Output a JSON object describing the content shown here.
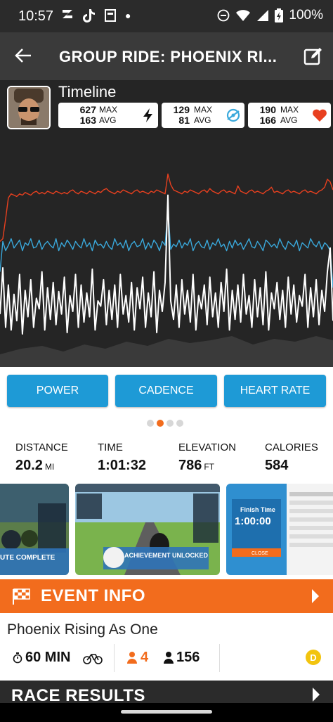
{
  "status_bar": {
    "time": "10:57",
    "battery": "100%",
    "notification_icons": [
      "zwift-icon",
      "tiktok-icon",
      "news-icon"
    ],
    "system_icons": [
      "dnd-icon",
      "wifi-icon",
      "signal-icon",
      "battery-icon"
    ]
  },
  "app_bar": {
    "title": "GROUP RIDE: PHOENIX RI...",
    "back_icon": "back-arrow-icon",
    "edit_icon": "edit-icon"
  },
  "timeline": {
    "title": "Timeline",
    "power": {
      "max": "627",
      "avg": "163",
      "max_label": "MAX",
      "avg_label": "AVG",
      "icon": "lightning-icon"
    },
    "cadence": {
      "max": "129",
      "avg": "81",
      "max_label": "MAX",
      "avg_label": "AVG",
      "icon": "cadence-icon"
    },
    "heart_rate": {
      "max": "190",
      "avg": "166",
      "max_label": "MAX",
      "avg_label": "AVG",
      "icon": "heart-icon"
    }
  },
  "chart_data": {
    "type": "line",
    "title": "",
    "xlabel": "",
    "ylabel": "",
    "series": [
      {
        "color": "#e8401f",
        "values": [
          95,
          97,
          112,
          128,
          131,
          130,
          129,
          131,
          130,
          132,
          131,
          130,
          132,
          133,
          131,
          132,
          131,
          133,
          132,
          131,
          133,
          132,
          131,
          132,
          131,
          133,
          134,
          132,
          131,
          133,
          132,
          131,
          133,
          132,
          131,
          133,
          132,
          134,
          135,
          133,
          132,
          131,
          133,
          132,
          134,
          133,
          132,
          131,
          133,
          134,
          132,
          133,
          132,
          131,
          133,
          132,
          134,
          133,
          132,
          131,
          146,
          138,
          134,
          133,
          132,
          131,
          133,
          132,
          134,
          133,
          132,
          131,
          133,
          134,
          132,
          135,
          133,
          132,
          131,
          133,
          134,
          132,
          133,
          132,
          131,
          137,
          133,
          132,
          131,
          133,
          134,
          132,
          133,
          132,
          131,
          133,
          134,
          136,
          132,
          133,
          132,
          131,
          133,
          134,
          132,
          133,
          132,
          131,
          133,
          134,
          132,
          133,
          132,
          131,
          133,
          134,
          136,
          142,
          140,
          134
        ]
      },
      {
        "color": "#3aa9dc",
        "values": [
          72,
          95,
          88,
          92,
          97,
          90,
          93,
          96,
          88,
          94,
          92,
          97,
          90,
          91,
          96,
          89,
          93,
          95,
          92,
          90,
          97,
          88,
          94,
          91,
          96,
          93,
          89,
          95,
          92,
          90,
          97,
          91,
          94,
          88,
          96,
          92,
          93,
          90,
          95,
          91,
          89,
          97,
          92,
          94,
          90,
          96,
          88,
          93,
          95,
          91,
          92,
          97,
          89,
          94,
          90,
          96,
          93,
          88,
          95,
          92,
          120,
          89,
          93,
          91,
          96,
          90,
          94,
          92,
          97,
          88,
          93,
          95,
          91,
          90,
          96,
          89,
          94,
          92,
          97,
          91,
          93,
          88,
          95,
          90,
          96,
          92,
          94,
          89,
          93,
          97,
          91,
          90,
          95,
          92,
          88,
          96,
          94,
          91,
          93,
          90,
          97,
          92,
          89,
          95,
          93,
          91,
          96,
          88,
          94,
          92,
          90,
          97,
          93,
          91,
          95,
          89,
          94,
          92,
          88,
          60
        ]
      },
      {
        "color": "#ffffff",
        "values": [
          40,
          75,
          30,
          62,
          28,
          55,
          35,
          70,
          25,
          58,
          38,
          66,
          30,
          52,
          44,
          72,
          28,
          60,
          36,
          64,
          32,
          57,
          40,
          68,
          26,
          54,
          42,
          70,
          30,
          62,
          34,
          56,
          38,
          74,
          28,
          50,
          46,
          66,
          32,
          58,
          36,
          62,
          30,
          70,
          40,
          54,
          34,
          64,
          28,
          60,
          44,
          68,
          30,
          56,
          38,
          72,
          26,
          58,
          42,
          64,
          130,
          50,
          36,
          62,
          30,
          66,
          40,
          58,
          34,
          70,
          28,
          54,
          44,
          62,
          32,
          68,
          38,
          56,
          30,
          64,
          42,
          74,
          28,
          58,
          36,
          62,
          34,
          70,
          40,
          54,
          30,
          66,
          38,
          60,
          32,
          72,
          28,
          56,
          44,
          64,
          36,
          58,
          30,
          68,
          40,
          62,
          34,
          54,
          46,
          70,
          30,
          60,
          38,
          66,
          32,
          58,
          42,
          72,
          90,
          35
        ]
      }
    ]
  },
  "buttons": {
    "power": "POWER",
    "cadence": "CADENCE",
    "heart_rate": "HEART RATE"
  },
  "summary": {
    "distance": {
      "label": "DISTANCE",
      "value": "20.2",
      "unit": "MI"
    },
    "time": {
      "label": "TIME",
      "value": "1:01:32"
    },
    "elevation": {
      "label": "ELEVATION",
      "value": "786",
      "unit": "FT"
    },
    "calories": {
      "label": "CALORIES",
      "value": "584"
    }
  },
  "thumbnails": [
    {
      "caption": "UTE COMPLETE"
    },
    {
      "caption": "ACHIEVEMENT UNLOCKED"
    },
    {
      "caption": "Finish Time",
      "time": "1:00:00",
      "button": "CLOSE"
    }
  ],
  "event": {
    "header": "EVENT INFO",
    "name": "Phoenix Rising As One",
    "duration": "60 MIN",
    "following_count": "4",
    "riders_count": "156",
    "category": "D"
  },
  "race_results": {
    "header": "RACE RESULTS"
  },
  "colors": {
    "orange": "#f26c1d",
    "blue": "#1e9ad6",
    "dark": "#252525",
    "red": "#e8401f",
    "cyan": "#3aa9dc"
  }
}
